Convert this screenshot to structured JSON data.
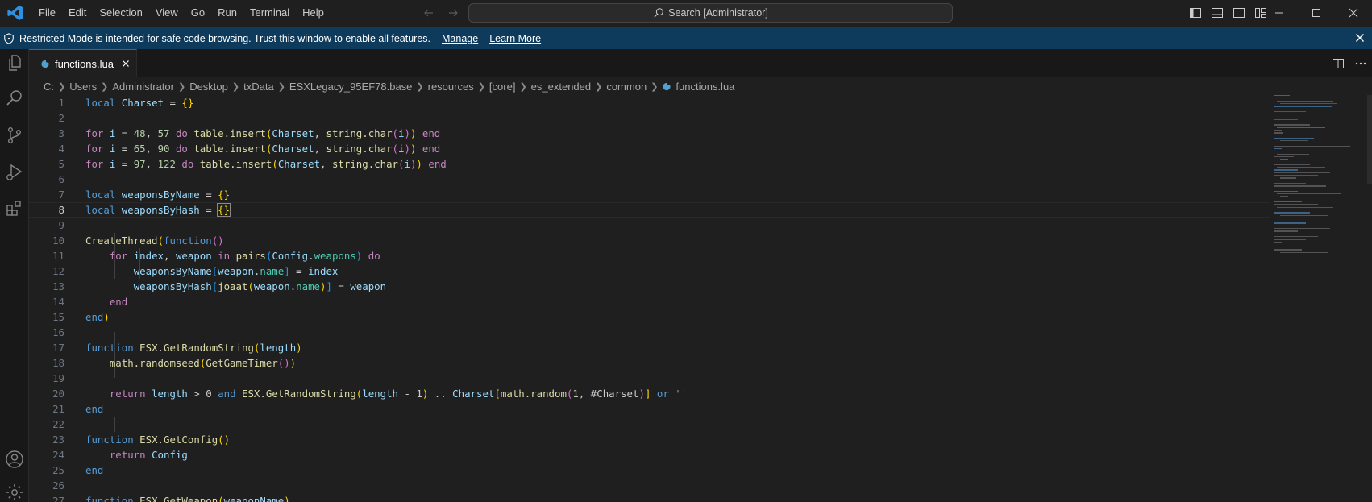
{
  "titlebar": {
    "menu": [
      "File",
      "Edit",
      "Selection",
      "View",
      "Go",
      "Run",
      "Terminal",
      "Help"
    ],
    "search_text": "Search [Administrator]"
  },
  "banner": {
    "message": "Restricted Mode is intended for safe code browsing. Trust this window to enable all features.",
    "manage_label": "Manage",
    "learn_more_label": "Learn More"
  },
  "tab": {
    "filename": "functions.lua"
  },
  "breadcrumb": [
    "C:",
    "Users",
    "Administrator",
    "Desktop",
    "txData",
    "ESXLegacy_95EF78.base",
    "resources",
    "[core]",
    "es_extended",
    "common",
    "functions.lua"
  ],
  "editor": {
    "active_line": 8,
    "lines": [
      {
        "n": "1"
      },
      {
        "n": "2"
      },
      {
        "n": "3"
      },
      {
        "n": "4"
      },
      {
        "n": "5"
      },
      {
        "n": "6"
      },
      {
        "n": "7"
      },
      {
        "n": "8"
      },
      {
        "n": "9"
      },
      {
        "n": "10"
      },
      {
        "n": "11"
      },
      {
        "n": "12"
      },
      {
        "n": "13"
      },
      {
        "n": "14"
      },
      {
        "n": "15"
      },
      {
        "n": "16"
      },
      {
        "n": "17"
      },
      {
        "n": "18"
      },
      {
        "n": "19"
      },
      {
        "n": "20"
      },
      {
        "n": "21"
      },
      {
        "n": "22"
      },
      {
        "n": "23"
      },
      {
        "n": "24"
      },
      {
        "n": "25"
      },
      {
        "n": "26"
      },
      {
        "n": "27"
      }
    ],
    "tokens": {
      "local": "local",
      "Charset": "Charset",
      "eq": " = ",
      "empty_braces": "{}",
      "for": "for",
      "i": "i",
      "n48": "48",
      "n57": "57",
      "n65": "65",
      "n90": "90",
      "n97": "97",
      "n122": "122",
      "do": "do",
      "table_insert": "table.insert",
      "string_char": "string.char",
      "end": "end",
      "weaponsByName": "weaponsByName",
      "weaponsByHash": "weaponsByHash",
      "CreateThread": "CreateThread",
      "function": "function",
      "index": "index",
      "weapon": "weapon",
      "in": "in",
      "pairs": "pairs",
      "Config": "Config",
      "weapons": "weapons",
      "name": "name",
      "joaat": "joaat",
      "ESX": "ESX",
      "GetRandomString": "GetRandomString",
      "length": "length",
      "math_randomseed": "math.randomseed",
      "GetGameTimer": "GetGameTimer",
      "return": "return",
      "gt0": " > 0 ",
      "and": "and",
      "minus1": " - 1",
      "concat": " .. ",
      "math_random": "math.random",
      "one": "1",
      "hashCharset": "#Charset",
      "or": "or",
      "emptystr": "''",
      "GetConfig": "GetConfig",
      "GetWeapon": "GetWeapon",
      "weaponName": "weaponName"
    }
  }
}
